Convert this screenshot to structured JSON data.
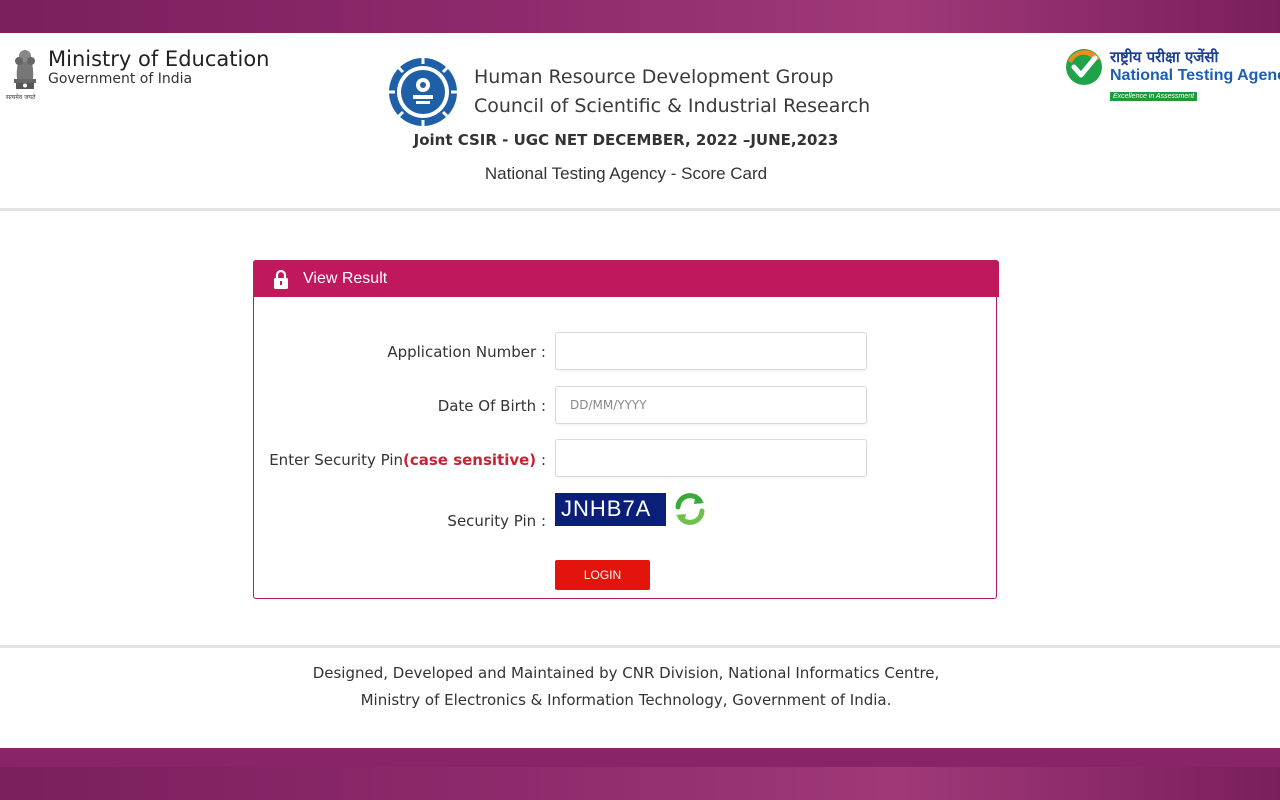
{
  "header": {
    "ministry_title": "Ministry of Education",
    "ministry_sub": "Government of India",
    "emblem_caption": "सत्यमेव जयते",
    "csir_line1": "Human Resource Development Group",
    "csir_line2": "Council of Scientific & Industrial Research",
    "exam_title": "Joint CSIR - UGC NET DECEMBER, 2022 –JUNE,2023",
    "exam_subtitle": "National Testing Agency - Score Card",
    "nta_hindi": "राष्ट्रीय परीक्षा एजेंसी",
    "nta_english": "National Testing Agency",
    "nta_tagline": "Excellence in Assessment"
  },
  "panel": {
    "title": "View Result",
    "application_label": "Application Number :",
    "application_value": "",
    "dob_label": "Date Of Birth :",
    "dob_placeholder": "DD/MM/YYYY",
    "security_label_prefix": "Enter Security Pin",
    "security_label_note": "(case sensitive)",
    "security_label_suffix": " :",
    "security_value": "",
    "captcha_label": "Security Pin :",
    "captcha_value": "JNHB7A",
    "login_label": "LOGIN"
  },
  "footer": {
    "line1": "Designed, Developed and Maintained by CNR Division, National Informatics Centre,",
    "line2": "Ministry of Electronics & Information Technology, Government of India."
  },
  "colors": {
    "accent": "#c0185d",
    "login": "#e3140c",
    "captcha_bg": "#0a1f7a",
    "frame": "#8a2468"
  },
  "icons": [
    "state-emblem-icon",
    "csir-logo-icon",
    "nta-check-icon",
    "lock-icon",
    "refresh-icon"
  ]
}
